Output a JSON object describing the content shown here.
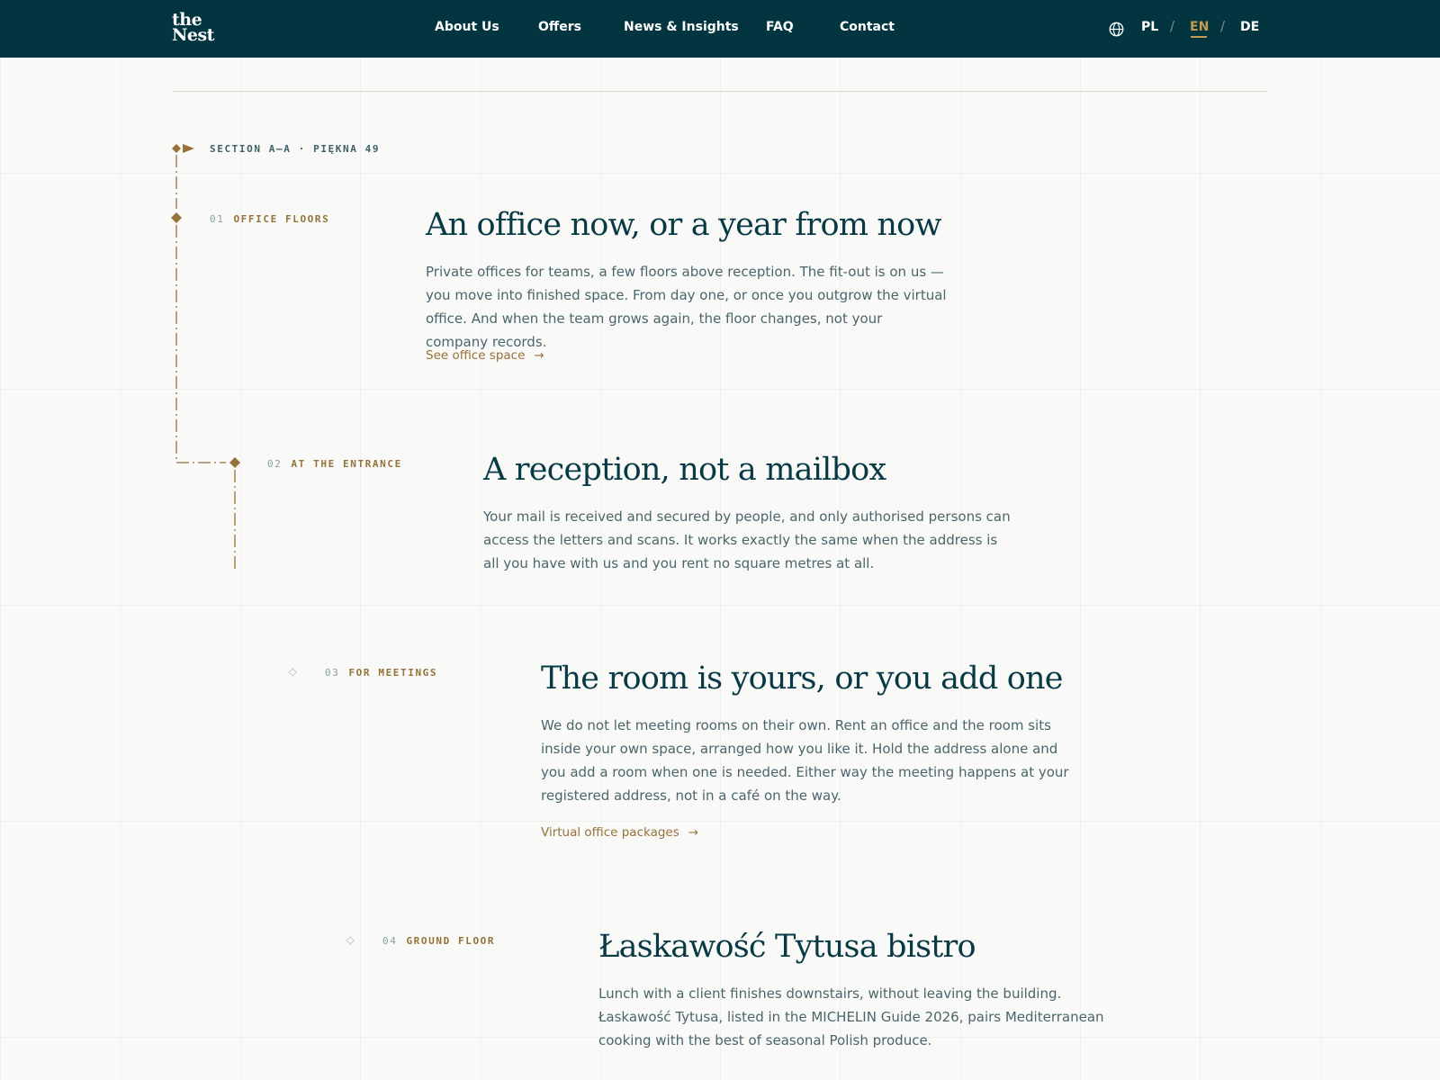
{
  "header": {
    "logo_line1": "the",
    "logo_line2": "Nest",
    "nav": [
      "About Us",
      "Offers",
      "News & Insights",
      "FAQ",
      "Contact"
    ],
    "languages": [
      "PL",
      "EN",
      "DE"
    ],
    "active_language": "EN",
    "lang_separator": "/"
  },
  "section_tag": "SECTION A–A · PIĘKNA 49",
  "sections": [
    {
      "num": "01",
      "label": "OFFICE FLOORS",
      "title": "An office now, or a year from now",
      "body": "Private offices for teams, a few floors above reception. The fit-out is on us — you move into finished space. From day one, or once you outgrow the virtual office. And when the team grows again, the floor changes, not your company records.",
      "link": "See office space",
      "arrow": "→"
    },
    {
      "num": "02",
      "label": "AT THE ENTRANCE",
      "title": "A reception, not a mailbox",
      "body": "Your mail is received and secured by people, and only authorised persons can access the letters and scans. It works exactly the same when the address is all you have with us and you rent no square metres at all."
    },
    {
      "num": "03",
      "label": "FOR MEETINGS",
      "title": "The room is yours, or you add one",
      "body": "We do not let meeting rooms on their own. Rent an office and the room sits inside your own space, arranged how you like it. Hold the address alone and you add a room when one is needed. Either way the meeting happens at your registered address, not in a café on the way.",
      "link": "Virtual office packages",
      "arrow": "→"
    },
    {
      "num": "04",
      "label": "GROUND FLOOR",
      "title": "Łaskawość Tytusa bistro",
      "body": "Lunch with a client finishes downstairs, without leaving the building. Łaskawość Tytusa, listed in the MICHELIN Guide 2026, pairs Mediterranean cooking with the best of seasonal Polish produce."
    }
  ],
  "colors": {
    "header_bg": "#023540",
    "accent_gold": "#95723a",
    "active_lang": "#c69a4f",
    "title": "#073a44",
    "body": "#4a666c"
  }
}
